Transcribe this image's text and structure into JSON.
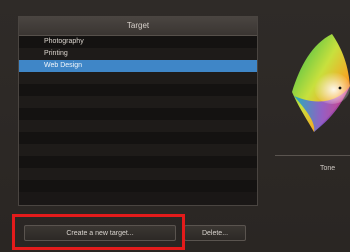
{
  "list": {
    "header": "Target",
    "items": [
      {
        "label": "Photography",
        "selected": false
      },
      {
        "label": "Printing",
        "selected": false
      },
      {
        "label": "Web Design",
        "selected": true
      }
    ],
    "empty_rows": 10
  },
  "buttons": {
    "create": "Create a new target...",
    "delete": "Delete..."
  },
  "right_panel": {
    "label": "Tone"
  },
  "colors": {
    "selection": "#3f86c7",
    "highlight_box": "#e31b1b",
    "background": "#2b2724"
  }
}
